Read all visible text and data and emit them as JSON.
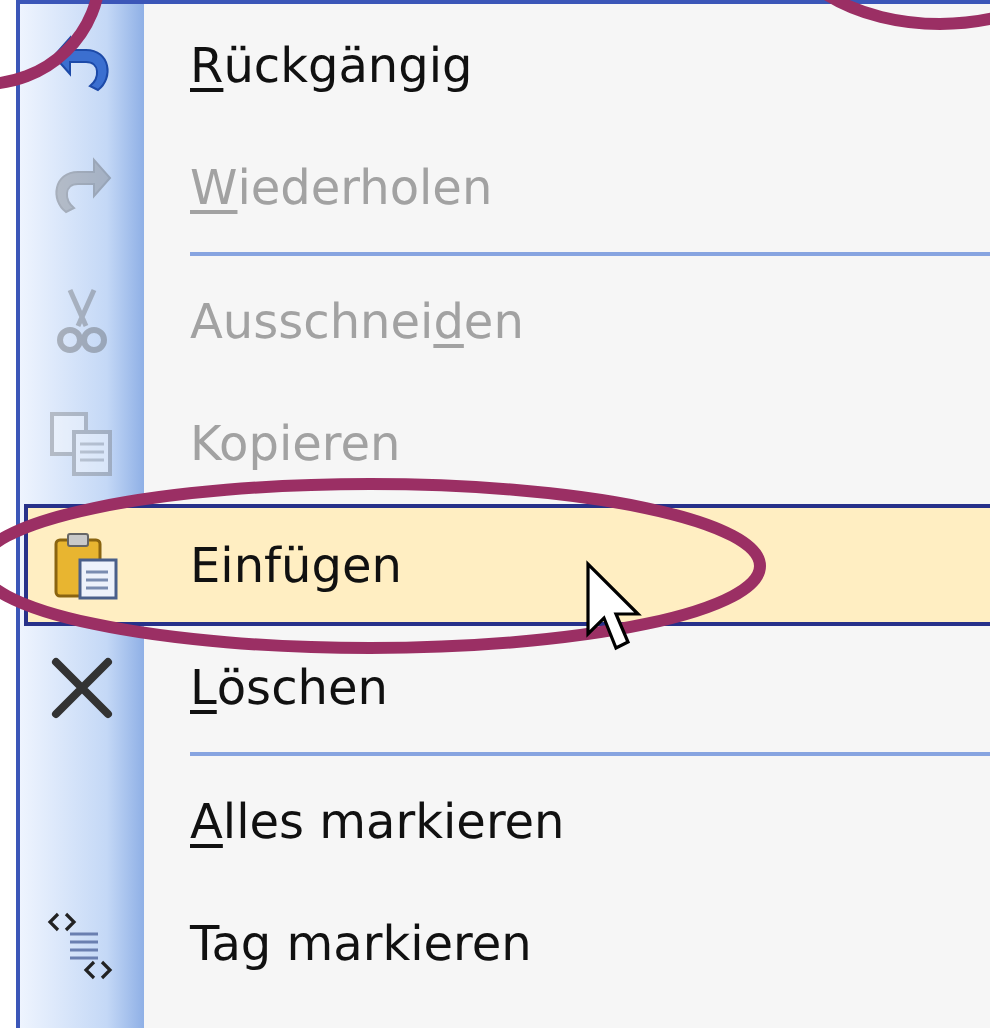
{
  "context_menu": {
    "items": [
      {
        "kind": "item",
        "label": "Rückgängig",
        "disabled": false,
        "selected": false
      },
      {
        "kind": "item",
        "label": "Wiederholen",
        "disabled": true,
        "selected": false
      },
      {
        "kind": "separator"
      },
      {
        "kind": "item",
        "label": "Ausschneiden",
        "disabled": true,
        "selected": false
      },
      {
        "kind": "item",
        "label": "Kopieren",
        "disabled": true,
        "selected": false
      },
      {
        "kind": "item",
        "label": "Einfügen",
        "disabled": false,
        "selected": true
      },
      {
        "kind": "item",
        "label": "Löschen",
        "disabled": false,
        "selected": false
      },
      {
        "kind": "separator"
      },
      {
        "kind": "item",
        "label": "Alles markieren",
        "disabled": false,
        "selected": false
      },
      {
        "kind": "item",
        "label": "Tag markieren",
        "disabled": false,
        "selected": false
      }
    ]
  }
}
